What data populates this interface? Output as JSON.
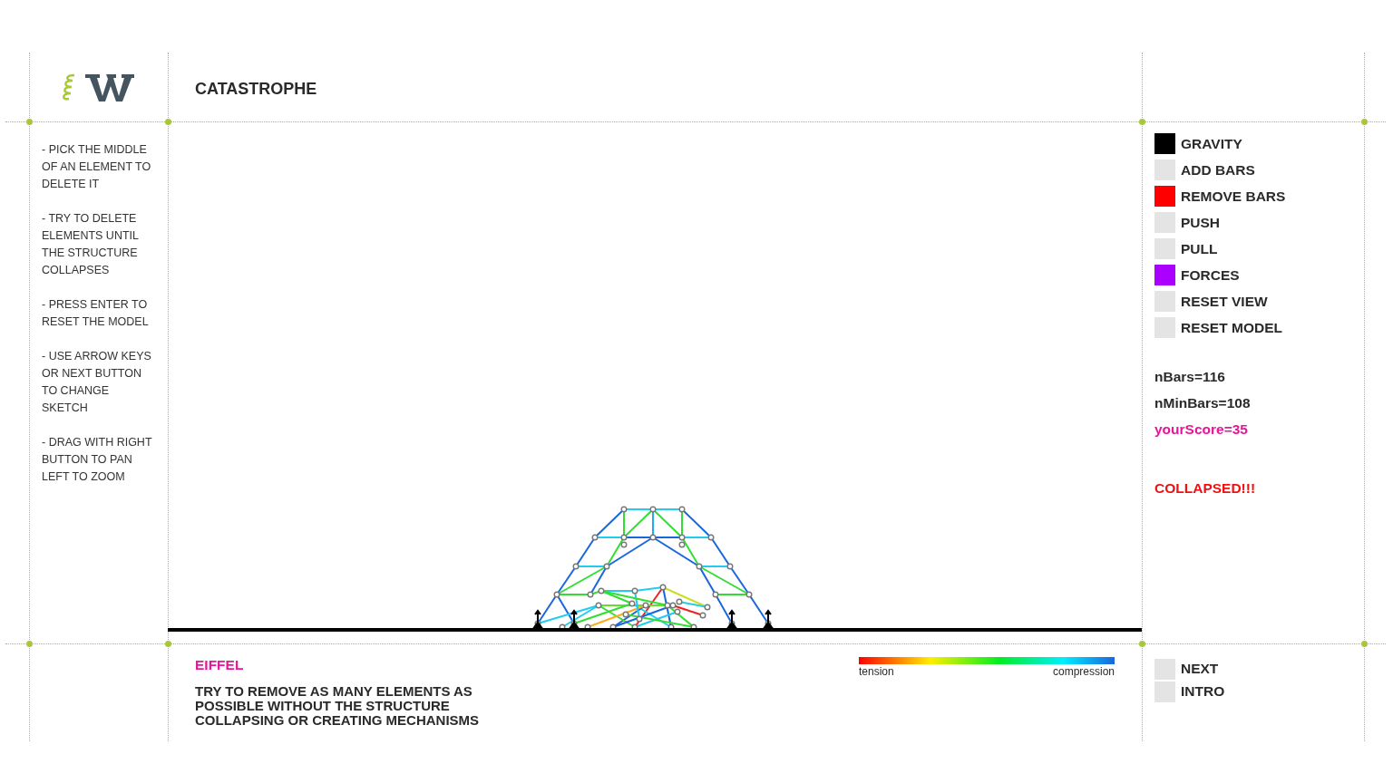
{
  "header": {
    "title": "CATASTROPHE"
  },
  "instructions": [
    "- PICK THE MIDDLE OF AN ELEMENT TO DELETE IT",
    "- TRY TO DELETE ELEMENTS UNTIL THE STRUCTURE COLLAPSES",
    "- PRESS ENTER TO RESET THE MODEL",
    "- USE ARROW KEYS OR NEXT BUTTON TO CHANGE SKETCH",
    "- DRAG WITH RIGHT BUTTON TO PAN LEFT TO ZOOM"
  ],
  "toggles": [
    {
      "label": "GRAVITY",
      "on": true,
      "color": "#000000"
    },
    {
      "label": "ADD BARS",
      "on": false
    },
    {
      "label": "REMOVE BARS",
      "on": true,
      "color": "#ff0000"
    },
    {
      "label": "PUSH",
      "on": false
    },
    {
      "label": "PULL",
      "on": false
    },
    {
      "label": "FORCES",
      "on": true,
      "color": "#aa00ff"
    },
    {
      "label": "RESET VIEW",
      "on": false
    },
    {
      "label": "RESET MODEL",
      "on": false
    }
  ],
  "stats": {
    "n_bars": "nBars=116",
    "n_min_bars": "nMinBars=108",
    "score": "yourScore=35",
    "status": "COLLAPSED!!!"
  },
  "sketch": {
    "name": "EIFFEL",
    "goal": "TRY TO REMOVE AS MANY ELEMENTS AS POSSIBLE WITHOUT THE STRUCTURE COLLAPSING OR CREATING MECHANISMS"
  },
  "legend": {
    "low_label": "tension",
    "high_label": "compression"
  },
  "nav_buttons": [
    {
      "label": "NEXT",
      "on": false
    },
    {
      "label": "INTRO",
      "on": false
    }
  ]
}
